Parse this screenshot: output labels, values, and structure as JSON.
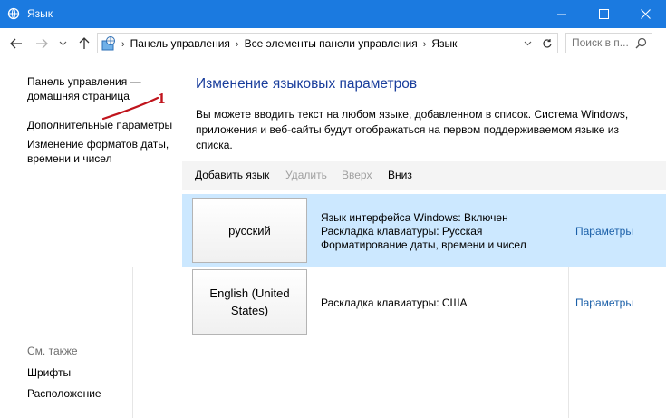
{
  "window": {
    "title": "Язык",
    "controls": {
      "minimize": "minimize",
      "maximize": "maximize",
      "close": "close"
    }
  },
  "address": {
    "breadcrumbs": [
      "Панель управления",
      "Все элементы панели управления",
      "Язык"
    ],
    "search_placeholder": "Поиск в п..."
  },
  "sidebar": {
    "links": [
      "Панель управления — домашняя страница",
      "Дополнительные параметры",
      "Изменение форматов даты, времени и чисел"
    ],
    "see_also_title": "См. также",
    "see_also": [
      "Шрифты",
      "Расположение"
    ]
  },
  "annotation": {
    "number": "1",
    "color": "#c0141c"
  },
  "main": {
    "heading": "Изменение языковых параметров",
    "description": "Вы можете вводить текст на любом языке, добавленном в список. Система Windows, приложения и веб-сайты будут отображаться на первом поддерживаемом языке из списка.",
    "toolbar": {
      "add": "Добавить язык",
      "remove": "Удалить",
      "up": "Вверх",
      "down": "Вниз"
    },
    "languages": [
      {
        "name": "русский",
        "info": [
          "Язык интерфейса Windows: Включен",
          "Раскладка клавиатуры: Русская",
          "Форматирование даты, времени и чисел"
        ],
        "options": "Параметры"
      },
      {
        "name": "English (United States)",
        "info": [
          "Раскладка клавиатуры: США"
        ],
        "options": "Параметры"
      }
    ]
  },
  "colors": {
    "titlebar": "#1b7ae0",
    "heading": "#1a3e9c",
    "link": "#1a5fa8",
    "selected_row": "#cce8ff"
  }
}
